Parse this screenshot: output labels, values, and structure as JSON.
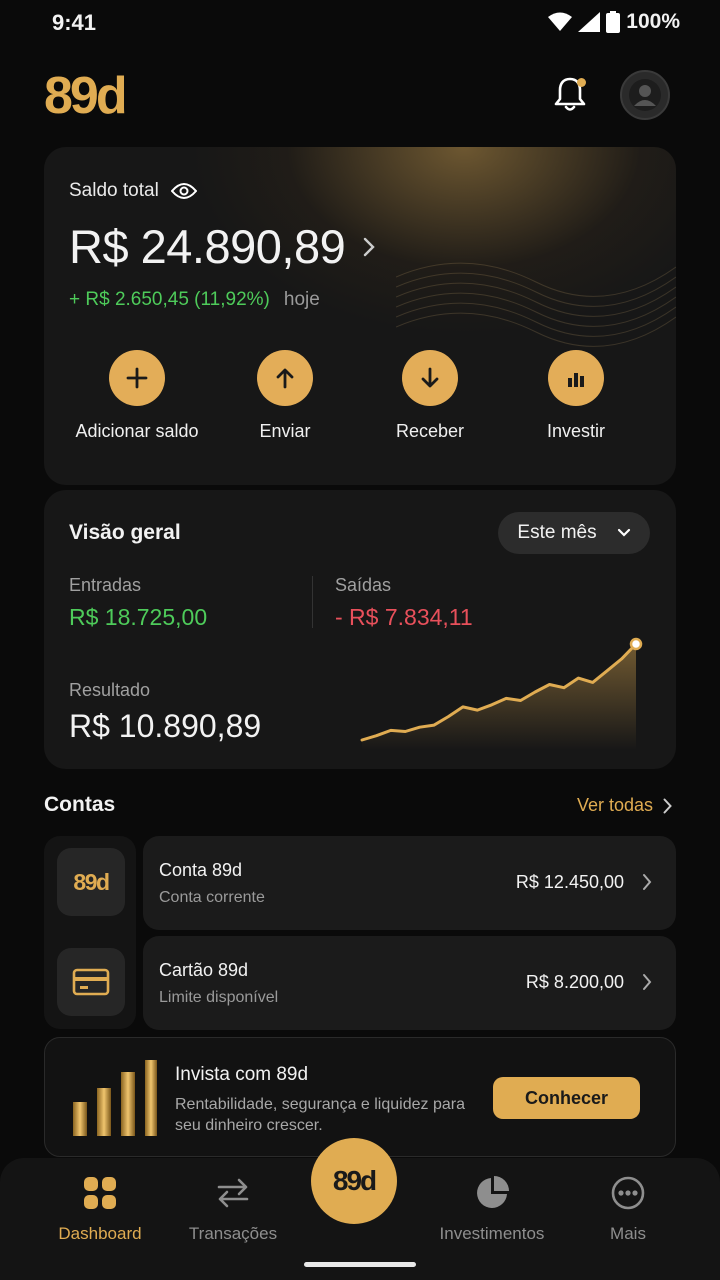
{
  "status_bar": {
    "time": "9:41",
    "battery": "100%"
  },
  "header": {
    "logo": "89d"
  },
  "balance": {
    "label": "Saldo total",
    "value": "R$ 24.890,89",
    "change": "+ R$ 2.650,45 (11,92%)",
    "period": "hoje",
    "actions": [
      {
        "label": "Adicionar saldo",
        "icon": "plus-icon"
      },
      {
        "label": "Enviar",
        "icon": "arrow-up-icon"
      },
      {
        "label": "Receber",
        "icon": "arrow-down-icon"
      },
      {
        "label": "Investir",
        "icon": "bar-chart-icon"
      }
    ]
  },
  "overview": {
    "title": "Visão geral",
    "period": "Este mês",
    "in_label": "Entradas",
    "in_value": "R$ 18.725,00",
    "out_label": "Saídas",
    "out_value": "- R$ 7.834,11",
    "result_label": "Resultado",
    "result_value": "R$ 10.890,89",
    "trend": [
      10,
      14,
      19,
      18,
      22,
      24,
      32,
      41,
      38,
      43,
      49,
      47,
      55,
      62,
      59,
      68,
      64,
      75,
      86,
      100
    ]
  },
  "accounts": {
    "title": "Contas",
    "see_all": "Ver todas",
    "items": [
      {
        "name": "Conta 89d",
        "sub": "Conta corrente",
        "value": "R$ 12.450,00",
        "icon_text": "89d"
      },
      {
        "name": "Cartão 89d",
        "sub": "Limite disponível",
        "value": "R$ 8.200,00",
        "icon": "card-icon"
      }
    ]
  },
  "invest_banner": {
    "title": "Invista com 89d",
    "desc": "Rentabilidade, segurança e liquidez para seu dinheiro crescer.",
    "button": "Conhecer"
  },
  "nav": {
    "items": [
      {
        "label": "Dashboard",
        "icon": "grid-icon"
      },
      {
        "label": "Transações",
        "icon": "swap-icon"
      },
      {
        "label": "Investimentos",
        "icon": "pie-icon"
      },
      {
        "label": "Mais",
        "icon": "more-icon"
      }
    ],
    "center": "89d"
  },
  "colors": {
    "accent": "#e0ac52",
    "positive": "#4ecb5a",
    "negative": "#e8505b"
  }
}
